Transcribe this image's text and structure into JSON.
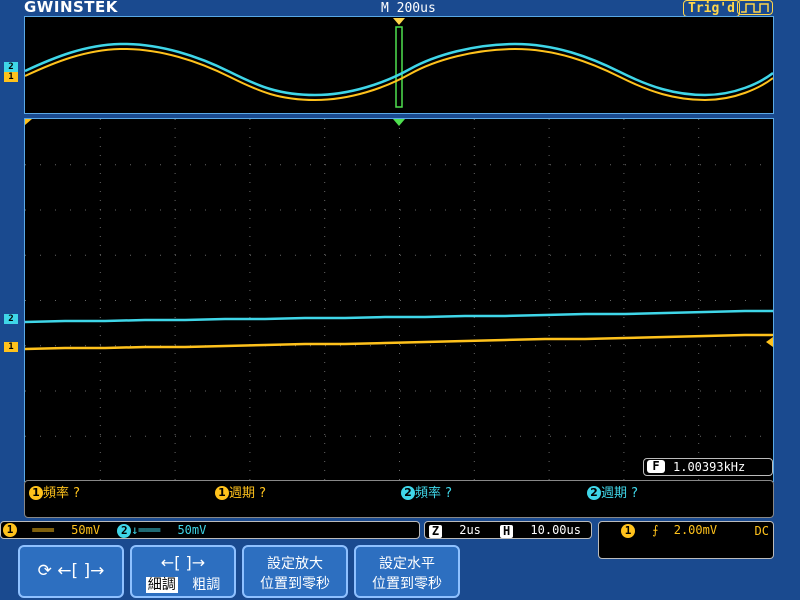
{
  "header": {
    "logo": "GWINSTEK",
    "timebase_mode": "M 200us",
    "trigger_status": "Trig'd"
  },
  "channels": [
    {
      "id": "1",
      "color": "#ffc21c"
    },
    {
      "id": "2",
      "color": "#3fd6e8"
    }
  ],
  "measurements": [
    {
      "channel": "1",
      "label": "頻率",
      "value": "?"
    },
    {
      "channel": "1",
      "label": "週期",
      "value": "?"
    },
    {
      "channel": "2",
      "label": "頻率",
      "value": "?"
    },
    {
      "channel": "2",
      "label": "週期",
      "value": "?"
    }
  ],
  "frequency_counter": {
    "badge": "F",
    "value": "1.00393kHz"
  },
  "status": {
    "ch1_coupling": "═══",
    "ch1_scale": "50mV",
    "ch2_coupling": "↓═══",
    "ch2_scale": "50mV"
  },
  "timebase": {
    "zoom_badge": "Z",
    "zoom_scale": "2us",
    "horizontal_badge": "H",
    "horizontal_position": "10.00us"
  },
  "trigger": {
    "source": "1",
    "slope": "⨍",
    "level": "2.00mV",
    "coupling": "DC"
  },
  "softkeys": {
    "key1_symbol": "←[ ]→",
    "key2_top": "←[ ]→",
    "key2_fine": "細調",
    "key2_coarse": "粗調",
    "key3_line1": "設定放大",
    "key3_line2": "位置到零秒",
    "key4_line1": "設定水平",
    "key4_line2": "位置到零秒"
  }
}
